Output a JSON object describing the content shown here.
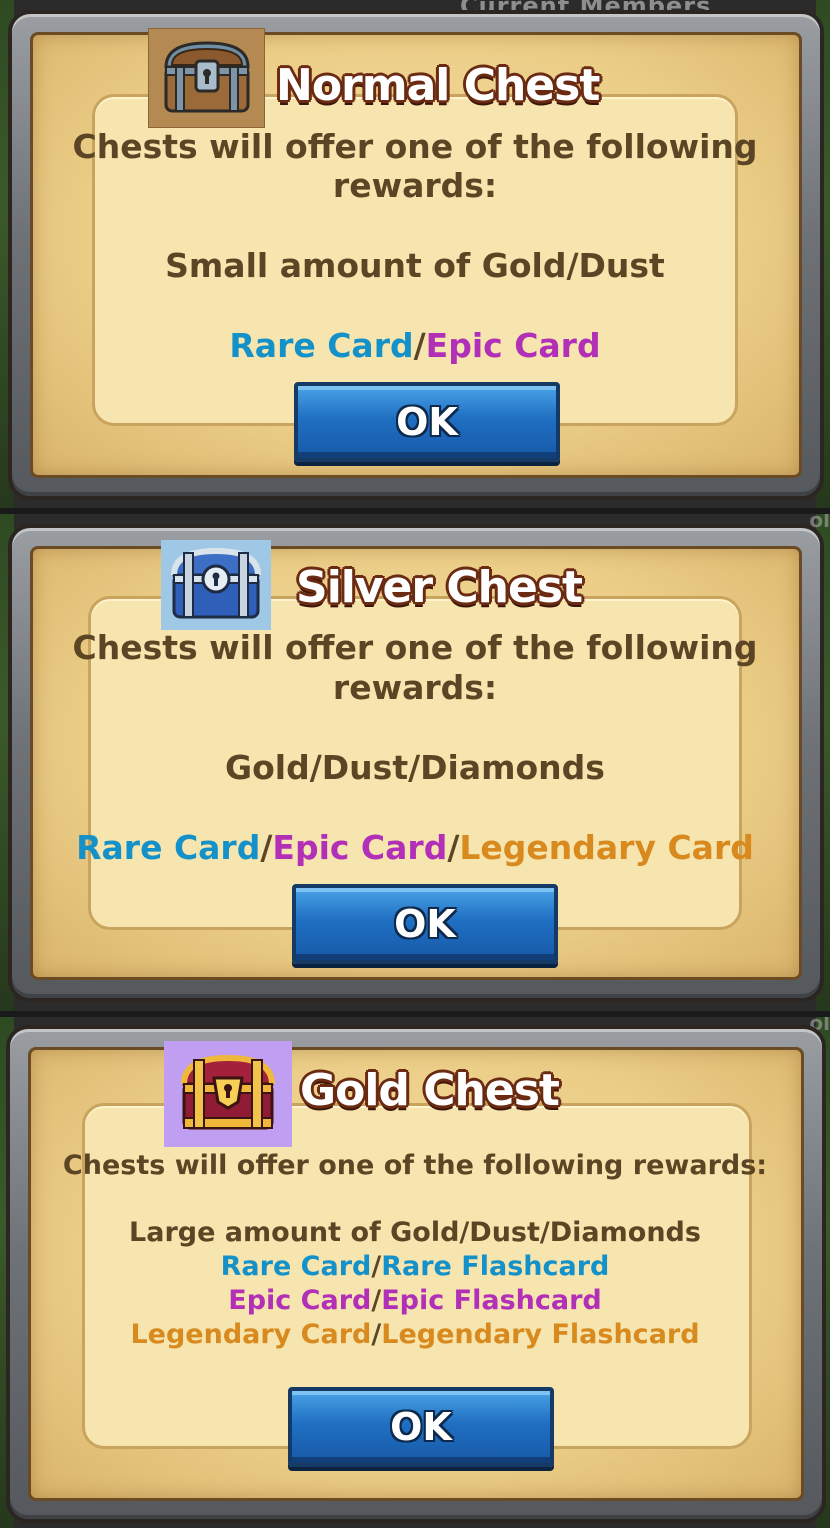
{
  "background": {
    "header_partial_text": "Current Members",
    "side_partial_text": "ol"
  },
  "dialogs": [
    {
      "title": "Normal Chest",
      "chest_color": "#b58a52",
      "chest_icon": "brown-chest-icon",
      "intro": "Chests will offer one of the following rewards:",
      "intro_line1": "Chests will offer one of the following",
      "intro_line2": "rewards:",
      "base_reward": "Small amount of Gold/Dust",
      "cards": [
        {
          "text": "Rare Card",
          "tier": "rare"
        },
        {
          "text": "/",
          "tier": "sep"
        },
        {
          "text": "Epic Card",
          "tier": "epic"
        }
      ],
      "ok_label": "OK"
    },
    {
      "title": "Silver Chest",
      "chest_color": "#9fc7e6",
      "chest_icon": "silver-chest-icon",
      "intro_line1": "Chests will offer one of the following",
      "intro_line2": "rewards:",
      "base_reward": "Gold/Dust/Diamonds",
      "cards": [
        {
          "text": "Rare Card",
          "tier": "rare"
        },
        {
          "text": "/",
          "tier": "sep"
        },
        {
          "text": "Epic Card",
          "tier": "epic"
        },
        {
          "text": "/",
          "tier": "sep"
        },
        {
          "text": "Legendary Card",
          "tier": "leg"
        }
      ],
      "ok_label": "OK"
    },
    {
      "title": "Gold Chest",
      "chest_color": "#c09ef2",
      "chest_icon": "gold-chest-icon",
      "intro": "Chests will offer one of the following rewards:",
      "base_reward": "Large amount of Gold/Dust/Diamonds",
      "card_lines": [
        [
          {
            "text": "Rare Card",
            "tier": "rare"
          },
          {
            "text": "/",
            "tier": "sep"
          },
          {
            "text": "Rare Flashcard",
            "tier": "rare"
          }
        ],
        [
          {
            "text": "Epic Card",
            "tier": "epic"
          },
          {
            "text": "/",
            "tier": "sep"
          },
          {
            "text": "Epic Flashcard",
            "tier": "epic"
          }
        ],
        [
          {
            "text": "Legendary Card",
            "tier": "leg"
          },
          {
            "text": "/",
            "tier": "sep"
          },
          {
            "text": "Legendary Flashcard",
            "tier": "leg"
          }
        ]
      ],
      "ok_label": "OK"
    }
  ],
  "colors": {
    "rare": "#1591c9",
    "epic": "#b22fb8",
    "legendary": "#d88a1f",
    "body_text": "#5c4525",
    "button": "#1f6fc2"
  }
}
